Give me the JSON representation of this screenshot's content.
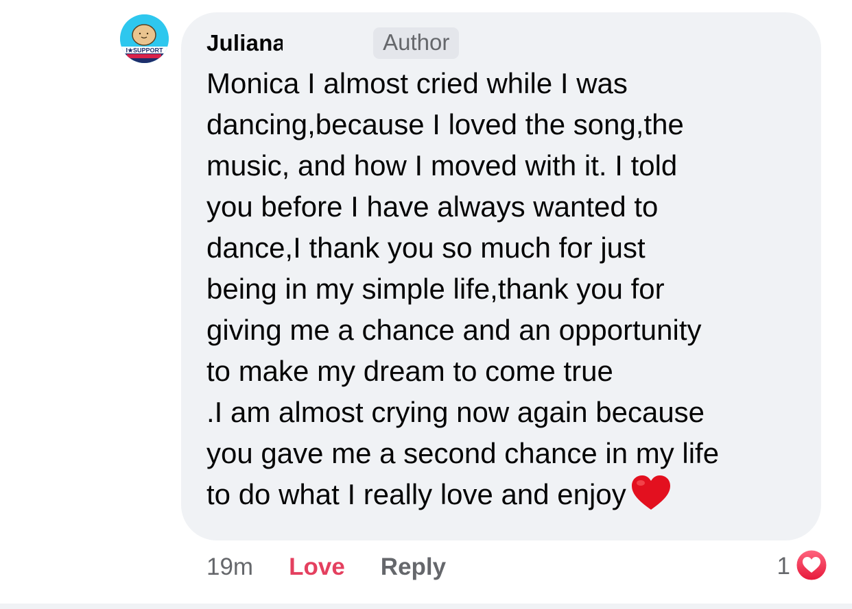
{
  "comment": {
    "author": "Juliana",
    "badge": "Author",
    "avatar_label": "I★SUPPORT",
    "text": "Monica I almost cried while I was\ndancing,because I loved the song,the\nmusic, and how I moved with it. I told\nyou before I have always wanted to\ndance,I thank you so much for just\nbeing  in my simple life,thank you for\ngiving me a chance and an opportunity\nto make my dream to come true\n.I am almost crying now again because\nyou gave me a second chance in my life\nto do what I really love and enjoy",
    "emoji": "red-heart-icon"
  },
  "footer": {
    "time": "19m",
    "love_label": "Love",
    "reply_label": "Reply",
    "reaction_count": "1",
    "reaction_icon": "love-reaction-icon"
  },
  "colors": {
    "bubble": "#f0f2f5",
    "love": "#e4405f",
    "secondary_text": "#65676b",
    "avatar_bg": "#2ec7ee"
  }
}
